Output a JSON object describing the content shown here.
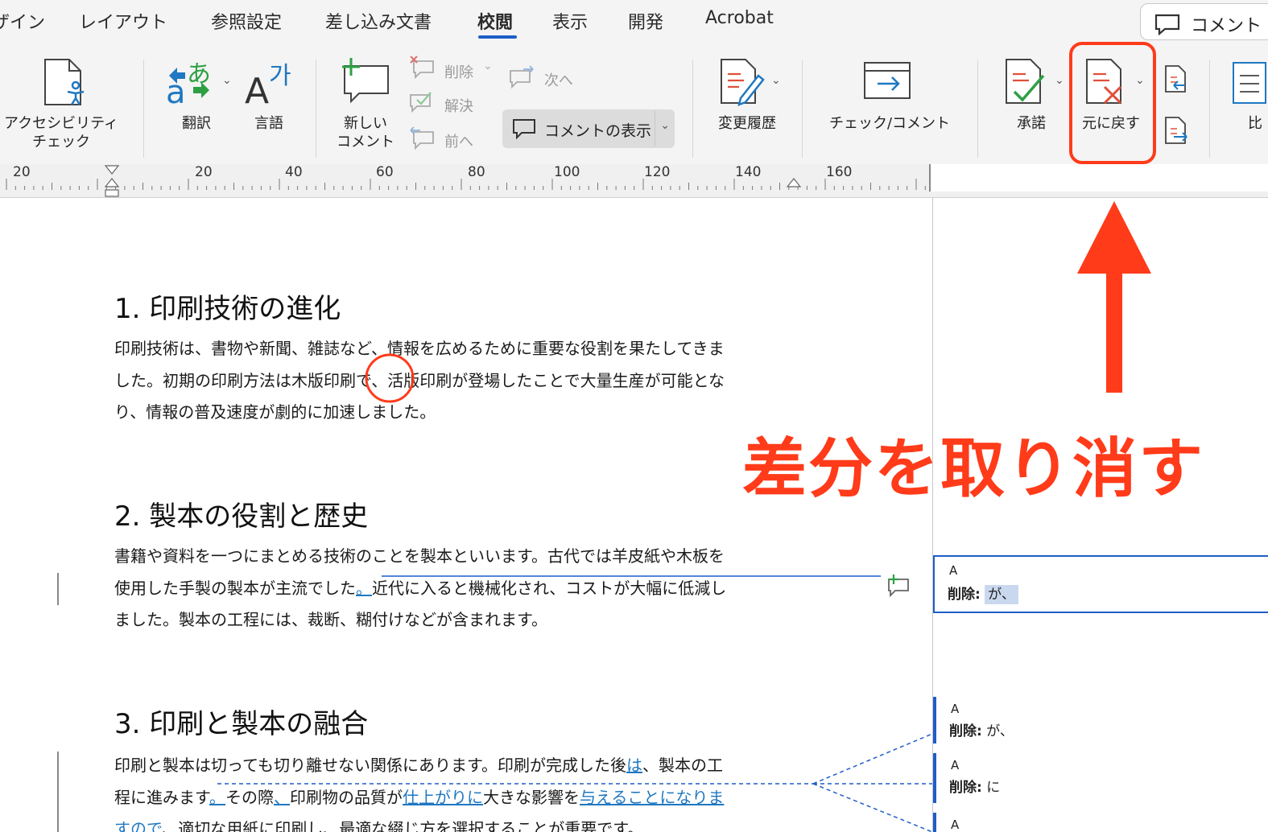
{
  "tabs": [
    "ザイン",
    "レイアウト",
    "参照設定",
    "差し込み文書",
    "校閲",
    "表示",
    "開発",
    "Acrobat"
  ],
  "active_tab": "校閲",
  "comment_button": "コメント",
  "ribbon": {
    "accessibility": [
      "アクセシビリティ",
      "チェック"
    ],
    "translate": "翻訳",
    "language": "言語",
    "new_comment": [
      "新しい",
      "コメント"
    ],
    "delete": "削除",
    "resolve": "解決",
    "previous": "前へ",
    "next": "次へ",
    "show_comments": "コメントの表示",
    "track_changes": "変更履歴",
    "check_comment": "チェック/コメント",
    "accept": "承諾",
    "reject": "元に戻す",
    "compare": "比"
  },
  "ruler_numbers": [
    "20",
    "20",
    "40",
    "60",
    "80",
    "100",
    "120",
    "140",
    "160"
  ],
  "doc": {
    "s1": {
      "heading": "1. 印刷技術の進化",
      "lines": [
        "印刷技術は、書物や新聞、雑誌など、情報を広めるために重要な役割を果たしてきま",
        "した。初期の印刷方法は木版印刷で、活版印刷が登場したことで大量生産が可能とな",
        "り、情報の普及速度が劇的に加速しました。"
      ]
    },
    "s2": {
      "heading": "2. 製本の役割と歴史",
      "line1": "書籍や資料を一つにまとめる技術のことを製本といいます。古代では羊皮紙や木板を",
      "line2a": "使用した手製の製本が主流でした",
      "line2ins": "。",
      "line2b": "近代に入ると機械化され、コストが大幅に低減し",
      "line3": "ました。製本の工程には、裁断、糊付けなどが含まれます。"
    },
    "s3": {
      "heading": "3. 印刷と製本の融合",
      "line1a": "印刷と製本は切っても切り離せない関係にあります。印刷が完成した後",
      "line1ins": "は",
      "line1b": "、製本の工",
      "line2a": "程に進みます",
      "line2ins1": "。",
      "line2b": "その際",
      "line2ins2": "、",
      "line2c": "印刷物の品質が",
      "line2ins3": "仕上がりに",
      "line2d": "大きな影響を",
      "line2ins4": "与えることになりま",
      "line3ins": "すので",
      "line3b": "、適切な用紙に印刷し、最適な綴じ方を選択することが重要です。"
    }
  },
  "comments": [
    {
      "author": "A",
      "label": "削除:",
      "text": "が、"
    },
    {
      "author": "A",
      "label": "削除:",
      "text": "が、"
    },
    {
      "author": "A",
      "label": "削除:",
      "text": "に"
    },
    {
      "author": "A",
      "label": "",
      "text": ""
    }
  ],
  "annotation": "差分を取り消す",
  "colors": {
    "accent": "#1f5dc8",
    "annotation_red": "#ff3b1a",
    "insert_blue": "#1f78c1",
    "ribbon_bg": "#f4f4f4"
  }
}
